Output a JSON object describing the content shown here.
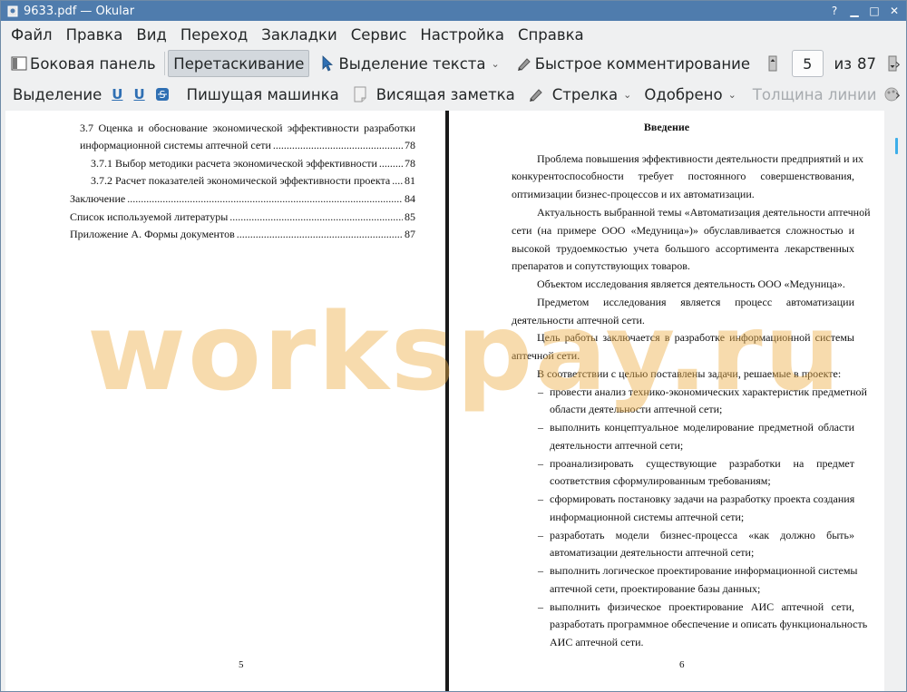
{
  "titlebar": {
    "title": "9633.pdf  — Okular"
  },
  "menubar": {
    "items": [
      "Файл",
      "Правка",
      "Вид",
      "Переход",
      "Закладки",
      "Сервис",
      "Настройка",
      "Справка"
    ]
  },
  "toolbar1": {
    "sidebar_label": "Боковая панель",
    "drag_label": "Перетаскивание",
    "text_select_label": "Выделение текста",
    "quick_comment_label": "Быстрое комментирование",
    "page_current": "5",
    "page_of": "из",
    "page_total": "87"
  },
  "toolbar2": {
    "highlight_label": "Выделение",
    "typewriter_label": "Пишущая машинка",
    "sticky_note_label": "Висящая заметка",
    "arrow_label": "Стрелка",
    "approved_label": "Одобрено",
    "line_width_label": "Толщина линии"
  },
  "left_page": {
    "toc": [
      {
        "text": "3.7  Оценка  и  обоснование  экономической  эффективности  разработки",
        "page": ""
      },
      {
        "text": "информационной системы аптечной сети",
        "page": "78"
      },
      {
        "text": "3.7.1 Выбор методики расчета экономической эффективности",
        "page": "78"
      },
      {
        "text": "3.7.2 Расчет показателей экономической эффективности проекта",
        "page": "81"
      },
      {
        "text": "Заключение",
        "page": "84"
      },
      {
        "text": "Список используемой литературы",
        "page": "85"
      },
      {
        "text": "Приложение  А. Формы документов",
        "page": "87"
      }
    ],
    "page_number": "5"
  },
  "right_page": {
    "heading": "Введение",
    "lines": [
      "Проблема повышения эффективности деятельности предприятий и их",
      "конкурентоспособности  требует  постоянного  совершенствования,",
      "оптимизации бизнес-процессов и их автоматизации.",
      "Актуальность выбранной темы «Автоматизация деятельности аптечной",
      "сети  (на  примере  ООО  «Медуница»)»  обуславливается  сложностью  и",
      "высокой  трудоемкостью  учета  большого  ассортимента  лекарственных",
      "препаратов и сопутствующих товаров.",
      "Объектом исследования является деятельность ООО «Медуница».",
      "Предметом  исследования  является  процесс  автоматизации",
      "деятельности аптечной сети.",
      "Цель  работы  заключается  в  разработке  информационной  системы",
      "аптечной сети.",
      "В соответствии с целью поставлены задачи, решаемые в проекте:"
    ],
    "bullets": [
      [
        "провести анализ технико-экономических характеристик предметной",
        "области деятельности аптечной сети;"
      ],
      [
        "выполнить  концептуальное  моделирование  предметной  области",
        "деятельности аптечной сети;"
      ],
      [
        "проанализировать  существующие  разработки  на  предмет",
        "соответствия сформулированным требованиям;"
      ],
      [
        "сформировать постановку задачи на разработку проекта создания",
        "информационной системы аптечной сети;"
      ],
      [
        "разработать  модели  бизнес-процесса  «как  должно  быть»",
        "автоматизации деятельности аптечной сети;"
      ],
      [
        "выполнить логическое проектирование информационной системы",
        "аптечной сети, проектирование базы данных;"
      ],
      [
        "выполнить  физическое  проектирование  АИС  аптечной  сети,",
        "разработать программное обеспечение и описать функциональность",
        "АИС аптечной сети."
      ]
    ],
    "bullet_mark": "–",
    "page_number": "6"
  },
  "watermark": "workspay.ru",
  "colors": {
    "titlebar": "#4f7cad",
    "watermark": "#eeb04a",
    "scroll_accent": "#3daee9"
  }
}
